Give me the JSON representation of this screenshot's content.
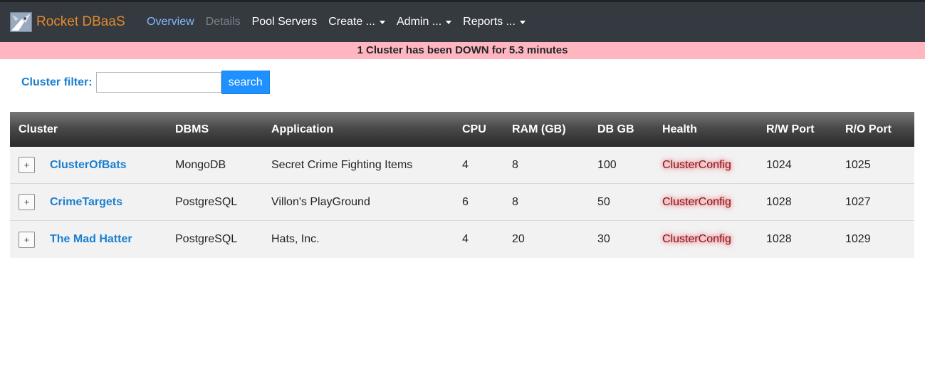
{
  "app": {
    "title": "Rocket DBaaS"
  },
  "nav": {
    "overview": "Overview",
    "details": "Details",
    "pool_servers": "Pool Servers",
    "create": "Create ...",
    "admin": "Admin ...",
    "reports": "Reports ..."
  },
  "alert": {
    "message": "1 Cluster has been DOWN for 5.3 minutes",
    "color": "#ffb6c1"
  },
  "filter": {
    "label": "Cluster filter:",
    "value": "",
    "placeholder": "",
    "button": "search"
  },
  "table": {
    "columns": [
      "Cluster",
      "DBMS",
      "Application",
      "CPU",
      "RAM (GB)",
      "DB GB",
      "Health",
      "R/W Port",
      "R/O Port"
    ],
    "rows": [
      {
        "expand": "+",
        "cluster": "ClusterOfBats",
        "dbms": "MongoDB",
        "application": "Secret Crime Fighting Items",
        "cpu": "4",
        "ram": "8",
        "db_gb": "100",
        "health": "ClusterConfig",
        "rw_port": "1024",
        "ro_port": "1025"
      },
      {
        "expand": "+",
        "cluster": "CrimeTargets",
        "dbms": "PostgreSQL",
        "application": "Villon's PlayGround",
        "cpu": "6",
        "ram": "8",
        "db_gb": "50",
        "health": "ClusterConfig",
        "rw_port": "1028",
        "ro_port": "1027"
      },
      {
        "expand": "+",
        "cluster": "The Mad Hatter",
        "dbms": "PostgreSQL",
        "application": "Hats, Inc.",
        "cpu": "4",
        "ram": "20",
        "db_gb": "30",
        "health": "ClusterConfig",
        "rw_port": "1028",
        "ro_port": "1029"
      }
    ]
  },
  "colors": {
    "accent": "#1a7fcf",
    "brand": "#e48a2a",
    "navbar": "#343a40",
    "search_button": "#1e90ff"
  }
}
